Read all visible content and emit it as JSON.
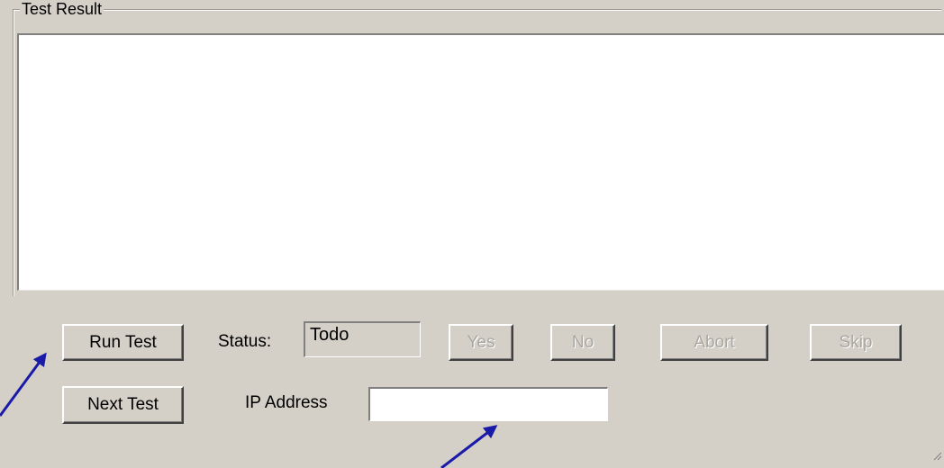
{
  "group": {
    "title": "Test Result"
  },
  "results": {
    "text": ""
  },
  "buttons": {
    "run_test": "Run Test",
    "next_test": "Next Test",
    "yes": "Yes",
    "no": "No",
    "abort": "Abort",
    "skip": "Skip"
  },
  "status": {
    "label": "Status:",
    "value": "Todo"
  },
  "ip": {
    "label": "IP Address",
    "value": ""
  },
  "colors": {
    "window_bg": "#d4d0c8",
    "annotation_arrow": "#1a1aa8",
    "disabled_text": "#a9a7a0"
  },
  "icons": {
    "resize_grip": "resize-grip-icon",
    "arrows": "annotation-arrow-icon"
  }
}
